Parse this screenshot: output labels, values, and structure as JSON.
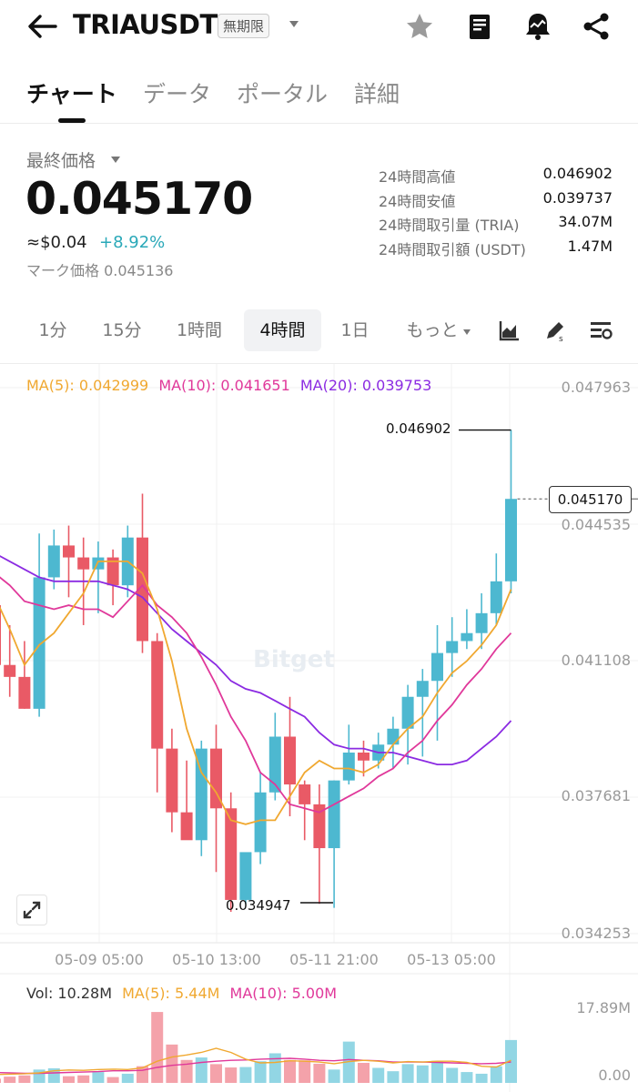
{
  "header": {
    "symbol": "TRIAUSDT",
    "contract_badge": "無期限"
  },
  "tabs": [
    "チャート",
    "データ",
    "ポータル",
    "詳細"
  ],
  "price": {
    "last_label": "最終価格",
    "last": "0.045170",
    "approx_usd": "≈$0.04",
    "change": "+8.92%",
    "mark_label": "マーク価格",
    "mark": "0.045136"
  },
  "stats": [
    {
      "label": "24時間高値",
      "value": "0.046902"
    },
    {
      "label": "24時間安値",
      "value": "0.039737"
    },
    {
      "label": "24時間取引量 (TRIA)",
      "value": "34.07M"
    },
    {
      "label": "24時間取引額 (USDT)",
      "value": "1.47M"
    }
  ],
  "intervals": [
    "1分",
    "15分",
    "1時間",
    "4時間",
    "1日",
    "もっと"
  ],
  "active_interval": "4時間",
  "ma_legend": {
    "ma5": "MA(5): 0.042999",
    "ma10": "MA(10): 0.041651",
    "ma20": "MA(20): 0.039753"
  },
  "price_axis": [
    "0.047963",
    "0.044535",
    "0.041108",
    "0.037681",
    "0.034253"
  ],
  "time_axis": [
    "05-09 05:00",
    "05-10 13:00",
    "05-11 21:00",
    "05-13 05:00"
  ],
  "annotations": {
    "high": "0.046902",
    "low": "0.034947",
    "current": "0.045170"
  },
  "watermark": "Bitget",
  "volume": {
    "vol": "Vol: 10.28M",
    "ma5": "MA(5): 5.44M",
    "ma10": "MA(10): 5.00M",
    "axis_top": "17.89M",
    "axis_bottom": "0.00"
  },
  "colors": {
    "up": "#4db8d0",
    "down": "#e95a66",
    "ma5": "#f0a830",
    "ma10": "#e0389a",
    "ma20": "#8b2be2",
    "positive_text": "#29a8b8"
  },
  "chart_data": {
    "type": "candlestick",
    "ylim": [
      0.034253,
      0.047963
    ],
    "candles": [
      {
        "o": 0.0425,
        "h": 0.0436,
        "l": 0.0408,
        "c": 0.041
      },
      {
        "o": 0.041,
        "h": 0.042,
        "l": 0.0402,
        "c": 0.0407
      },
      {
        "o": 0.0407,
        "h": 0.0416,
        "l": 0.0399,
        "c": 0.0399
      },
      {
        "o": 0.0399,
        "h": 0.0443,
        "l": 0.0397,
        "c": 0.0432
      },
      {
        "o": 0.0432,
        "h": 0.0444,
        "l": 0.0429,
        "c": 0.044
      },
      {
        "o": 0.044,
        "h": 0.0445,
        "l": 0.0427,
        "c": 0.0437
      },
      {
        "o": 0.0437,
        "h": 0.0442,
        "l": 0.042,
        "c": 0.0434
      },
      {
        "o": 0.0434,
        "h": 0.0441,
        "l": 0.0423,
        "c": 0.0437
      },
      {
        "o": 0.0437,
        "h": 0.0439,
        "l": 0.0425,
        "c": 0.043
      },
      {
        "o": 0.043,
        "h": 0.0445,
        "l": 0.0427,
        "c": 0.0442
      },
      {
        "o": 0.0442,
        "h": 0.0453,
        "l": 0.0413,
        "c": 0.0416
      },
      {
        "o": 0.0416,
        "h": 0.0418,
        "l": 0.0378,
        "c": 0.0389
      },
      {
        "o": 0.0389,
        "h": 0.0394,
        "l": 0.0368,
        "c": 0.0373
      },
      {
        "o": 0.0373,
        "h": 0.0386,
        "l": 0.0367,
        "c": 0.0366
      },
      {
        "o": 0.0366,
        "h": 0.0391,
        "l": 0.0362,
        "c": 0.0389
      },
      {
        "o": 0.0389,
        "h": 0.0395,
        "l": 0.0358,
        "c": 0.0374
      },
      {
        "o": 0.0374,
        "h": 0.0378,
        "l": 0.0348,
        "c": 0.0351
      },
      {
        "o": 0.0351,
        "h": 0.036,
        "l": 0.035,
        "c": 0.0363
      },
      {
        "o": 0.0363,
        "h": 0.0383,
        "l": 0.036,
        "c": 0.0378
      },
      {
        "o": 0.0378,
        "h": 0.0398,
        "l": 0.0376,
        "c": 0.0392
      },
      {
        "o": 0.0392,
        "h": 0.0402,
        "l": 0.0372,
        "c": 0.038
      },
      {
        "o": 0.038,
        "h": 0.0381,
        "l": 0.0366,
        "c": 0.0375
      },
      {
        "o": 0.0375,
        "h": 0.038,
        "l": 0.035,
        "c": 0.0364
      },
      {
        "o": 0.0364,
        "h": 0.0381,
        "l": 0.0349,
        "c": 0.0381
      },
      {
        "o": 0.0381,
        "h": 0.0395,
        "l": 0.038,
        "c": 0.0388
      },
      {
        "o": 0.0388,
        "h": 0.0391,
        "l": 0.0382,
        "c": 0.0386
      },
      {
        "o": 0.0386,
        "h": 0.0393,
        "l": 0.0384,
        "c": 0.039
      },
      {
        "o": 0.039,
        "h": 0.0397,
        "l": 0.0384,
        "c": 0.0394
      },
      {
        "o": 0.0394,
        "h": 0.0405,
        "l": 0.0385,
        "c": 0.0402
      },
      {
        "o": 0.0402,
        "h": 0.0409,
        "l": 0.0387,
        "c": 0.0406
      },
      {
        "o": 0.0406,
        "h": 0.042,
        "l": 0.0391,
        "c": 0.0413
      },
      {
        "o": 0.0413,
        "h": 0.0422,
        "l": 0.0407,
        "c": 0.0416
      },
      {
        "o": 0.0416,
        "h": 0.0424,
        "l": 0.0414,
        "c": 0.0418
      },
      {
        "o": 0.0418,
        "h": 0.0428,
        "l": 0.0414,
        "c": 0.0423
      },
      {
        "o": 0.0423,
        "h": 0.0438,
        "l": 0.042,
        "c": 0.0431
      },
      {
        "o": 0.0431,
        "h": 0.0469,
        "l": 0.0428,
        "c": 0.04517
      }
    ],
    "ma5": [
      0.0427,
      0.0419,
      0.041,
      0.0415,
      0.0418,
      0.0423,
      0.0428,
      0.0436,
      0.0436,
      0.0436,
      0.0433,
      0.0424,
      0.0411,
      0.0394,
      0.0383,
      0.0378,
      0.0371,
      0.037,
      0.0371,
      0.0371,
      0.0377,
      0.0383,
      0.0386,
      0.0384,
      0.0384,
      0.0383,
      0.0385,
      0.039,
      0.0394,
      0.0397,
      0.0403,
      0.0408,
      0.0411,
      0.0415,
      0.042,
      0.0429
    ],
    "ma10": [
      0.0433,
      0.043,
      0.0426,
      0.0425,
      0.0424,
      0.0425,
      0.0424,
      0.0424,
      0.0422,
      0.0426,
      0.043,
      0.0425,
      0.0422,
      0.0418,
      0.0412,
      0.0405,
      0.0397,
      0.0391,
      0.0383,
      0.038,
      0.0375,
      0.0374,
      0.0373,
      0.0375,
      0.0377,
      0.0379,
      0.0382,
      0.0384,
      0.0388,
      0.0391,
      0.0396,
      0.04,
      0.0405,
      0.0409,
      0.0414,
      0.0418
    ],
    "ma20": [
      0.0438,
      0.0436,
      0.0434,
      0.0432,
      0.0431,
      0.0431,
      0.0431,
      0.0431,
      0.043,
      0.0429,
      0.0427,
      0.0423,
      0.0419,
      0.0416,
      0.0413,
      0.041,
      0.0406,
      0.0404,
      0.0403,
      0.0401,
      0.0399,
      0.0397,
      0.0393,
      0.039,
      0.0389,
      0.0389,
      0.0388,
      0.0388,
      0.0387,
      0.0386,
      0.0385,
      0.0385,
      0.0386,
      0.0389,
      0.0392,
      0.0396
    ],
    "volume": {
      "ylim": [
        0,
        17.89
      ],
      "values": [
        1.0,
        1.5,
        1.8,
        3.2,
        3.5,
        1.6,
        1.8,
        2.6,
        1.4,
        2.2,
        4.0,
        17.0,
        9.2,
        5.5,
        6.1,
        4.5,
        3.7,
        3.8,
        5.2,
        7.1,
        5.5,
        5.4,
        4.6,
        3.2,
        9.9,
        4.8,
        3.6,
        2.8,
        4.5,
        4.2,
        5.3,
        3.6,
        2.6,
        2.2,
        4.0,
        10.28
      ],
      "ma5": [
        2.0,
        2.1,
        2.2,
        2.4,
        2.9,
        3.1,
        3.0,
        3.2,
        3.3,
        3.2,
        3.6,
        5.2,
        6.2,
        6.7,
        7.3,
        8.3,
        7.3,
        5.7,
        4.8,
        4.9,
        5.3,
        5.2,
        5.0,
        4.6,
        5.1,
        5.4,
        5.2,
        4.8,
        5.1,
        5.0,
        5.2,
        5.2,
        4.9,
        4.0,
        3.8,
        5.44
      ],
      "ma10": [
        2.5,
        2.4,
        2.3,
        2.3,
        2.4,
        2.5,
        2.6,
        2.7,
        2.9,
        2.9,
        3.0,
        3.7,
        4.2,
        4.5,
        4.9,
        5.2,
        5.4,
        5.5,
        5.7,
        5.8,
        5.9,
        5.7,
        5.4,
        5.3,
        5.6,
        5.4,
        5.3,
        5.0,
        5.0,
        5.0,
        4.9,
        4.8,
        4.7,
        4.6,
        4.7,
        5.0
      ]
    }
  }
}
